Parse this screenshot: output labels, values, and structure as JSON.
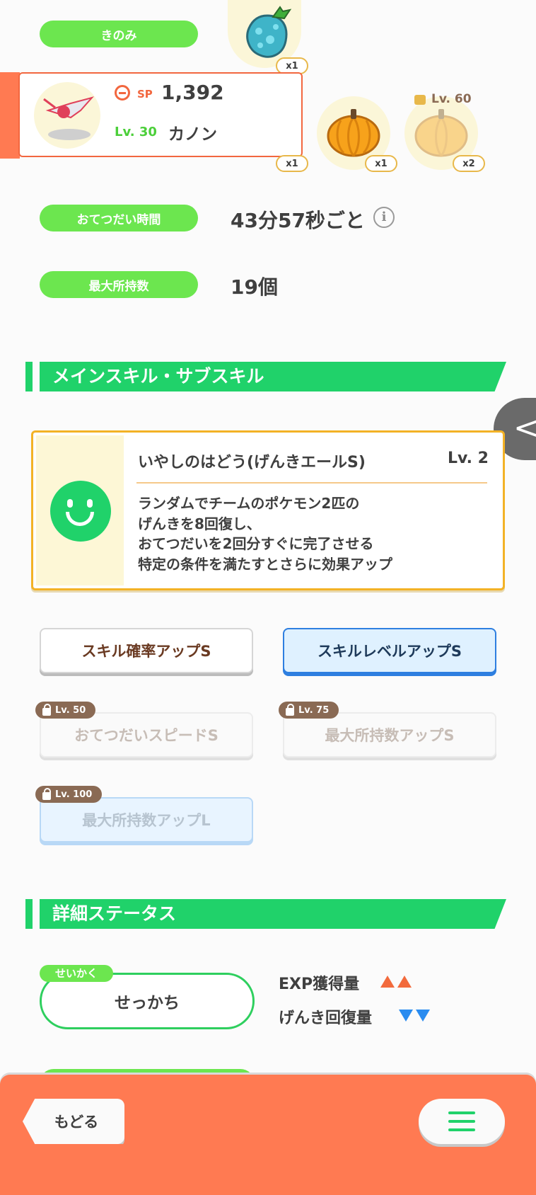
{
  "berry": {
    "label": "きのみ"
  },
  "pokemon": {
    "sp_label": "SP",
    "sp_value": "1,392",
    "level": "Lv. 30",
    "name": "カノン"
  },
  "ingredients": [
    {
      "name": "doyourbest-radish-icon",
      "count": "x1"
    },
    {
      "name": "pumpkin-icon",
      "count": "x1"
    },
    {
      "name": "pumpkin-icon",
      "count": "x1"
    },
    {
      "name": "pumpkin-locked-icon",
      "count": "x2",
      "lock_level": "Lv. 60"
    }
  ],
  "help_time": {
    "label": "おてつだい時間",
    "value": "43分57秒ごと"
  },
  "max_carry": {
    "label": "最大所持数",
    "value": "19個"
  },
  "skills_section": {
    "title": "メインスキル・サブスキル"
  },
  "main_skill": {
    "name": "いやしのはどう(げんきエールS)",
    "level": "Lv. 2",
    "desc_lines": [
      "ランダムでチームのポケモン2匹の",
      "げんきを8回復し、",
      "おてつだいを2回分すぐに完了させる",
      "特定の条件を満たすとさらに効果アップ"
    ]
  },
  "sub_skills": [
    {
      "label": "スキル確率アップS"
    },
    {
      "label": "スキルレベルアップS"
    },
    {
      "label": "おてつだいスピードS",
      "lock": "Lv. 50"
    },
    {
      "label": "最大所持数アップS",
      "lock": "Lv. 75"
    },
    {
      "label": "最大所持数アップL",
      "lock": "Lv. 100"
    }
  ],
  "details_section": {
    "title": "詳細ステータス"
  },
  "nature": {
    "tag": "せいかく",
    "value": "せっかち",
    "up_label": "EXP獲得量",
    "down_label": "げんき回復量"
  },
  "footer": {
    "back_label": "もどる"
  },
  "colors": {
    "green": "#6ce64f",
    "section_green": "#20d26a",
    "footer": "#ff7a52",
    "accent_red": "#f2673f"
  }
}
